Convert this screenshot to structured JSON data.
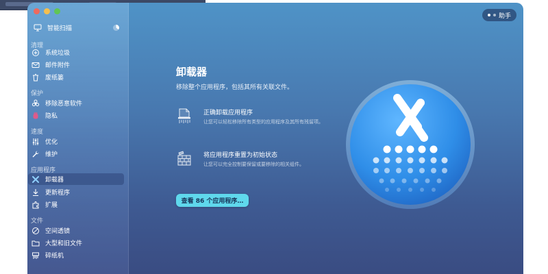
{
  "sidebar": {
    "smart_scan": {
      "label": "智能扫描",
      "icon": "monitor-icon"
    },
    "sections": [
      {
        "title": "清理",
        "items": [
          {
            "label": "系统垃圾",
            "icon": "system-junk-icon"
          },
          {
            "label": "邮件附件",
            "icon": "mail-icon"
          },
          {
            "label": "废纸篓",
            "icon": "trash-icon"
          }
        ]
      },
      {
        "title": "保护",
        "items": [
          {
            "label": "移除恶意软件",
            "icon": "biohazard-icon"
          },
          {
            "label": "隐私",
            "icon": "privacy-hand-icon"
          }
        ]
      },
      {
        "title": "速度",
        "items": [
          {
            "label": "优化",
            "icon": "sliders-icon"
          },
          {
            "label": "维护",
            "icon": "wrench-icon"
          }
        ]
      },
      {
        "title": "应用程序",
        "items": [
          {
            "label": "卸载器",
            "icon": "uninstaller-icon",
            "active": true
          },
          {
            "label": "更新程序",
            "icon": "updater-icon"
          },
          {
            "label": "扩展",
            "icon": "extensions-icon"
          }
        ]
      },
      {
        "title": "文件",
        "items": [
          {
            "label": "空间透镜",
            "icon": "space-lens-icon"
          },
          {
            "label": "大型和旧文件",
            "icon": "folder-icon"
          },
          {
            "label": "碎纸机",
            "icon": "shredder-icon"
          }
        ]
      }
    ]
  },
  "header": {
    "assistant_label": "助手"
  },
  "main": {
    "title": "卸载器",
    "subtitle": "移除整个应用程序，包括其所有关联文件。",
    "features": [
      {
        "title": "正确卸载应用程序",
        "desc": "让您可以轻松移除所有类型的应用程序及其所有残留项。",
        "icon": "shredder-app-icon"
      },
      {
        "title": "将应用程序重置为初始状态",
        "desc": "让您可以完全控制要保留或要移除的相关组件。",
        "icon": "reset-bricks-icon"
      }
    ],
    "cta_label": "查看 86 个应用程序…"
  },
  "colors": {
    "accent": "#5fd8ec",
    "hero_blue": "#2f8ee8",
    "active_bg": "#2c3c6e"
  }
}
